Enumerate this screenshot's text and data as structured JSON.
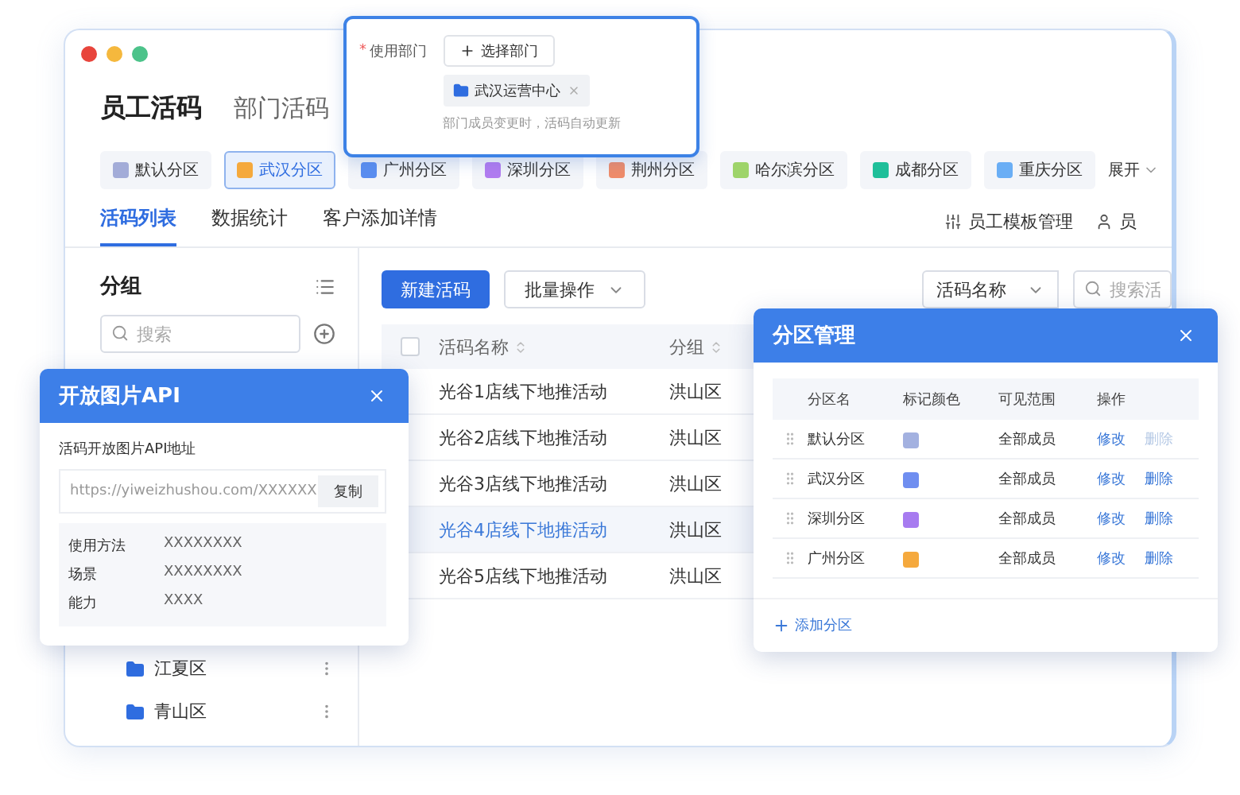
{
  "top_tabs": [
    {
      "label": "员工活码",
      "selected": true
    },
    {
      "label": "部门活码",
      "selected": false
    }
  ],
  "partitions": {
    "items": [
      {
        "label": "默认分区",
        "color": "#a3acd8",
        "selected": false
      },
      {
        "label": "武汉分区",
        "color": "#f5a93d",
        "selected": true
      },
      {
        "label": "广州分区",
        "color": "#5b8ef0",
        "selected": false
      },
      {
        "label": "深圳分区",
        "color": "#b27cf0",
        "selected": false
      },
      {
        "label": "荆州分区",
        "color": "#f08c6a",
        "selected": false
      },
      {
        "label": "哈尔滨分区",
        "color": "#9ed46a",
        "selected": false
      },
      {
        "label": "成都分区",
        "color": "#1fbf9a",
        "selected": false
      },
      {
        "label": "重庆分区",
        "color": "#6aaef5",
        "selected": false
      }
    ],
    "expand": "展开"
  },
  "sub_tabs": [
    {
      "label": "活码列表",
      "selected": true
    },
    {
      "label": "数据统计",
      "selected": false
    },
    {
      "label": "客户添加详情",
      "selected": false
    }
  ],
  "toolbar_links": [
    {
      "label": "员工模板管理",
      "kind": "template"
    },
    {
      "label": "员",
      "kind": "person"
    }
  ],
  "sidebar": {
    "title": "分组",
    "search_placeholder": "搜索",
    "groups": [
      {
        "label": "江夏区"
      },
      {
        "label": "青山区"
      }
    ]
  },
  "actions": {
    "primary": "新建活码",
    "batch": "批量操作",
    "filter": "活码名称",
    "search_placeholder": "搜索活"
  },
  "table": {
    "select_all": {
      "checked": false
    },
    "columns": [
      {
        "label": "活码名称",
        "sortable": true
      },
      {
        "label": "分组",
        "sortable": true
      }
    ],
    "rows": [
      {
        "name": "光谷1店线下地推活动",
        "group": "洪山区",
        "selected": false
      },
      {
        "name": "光谷2店线下地推活动",
        "group": "洪山区",
        "selected": false
      },
      {
        "name": "光谷3店线下地推活动",
        "group": "洪山区",
        "selected": false
      },
      {
        "name": "光谷4店线下地推活动",
        "group": "洪山区",
        "selected": true
      },
      {
        "name": "光谷5店线下地推活动",
        "group": "洪山区",
        "selected": false
      }
    ]
  },
  "dept_popup": {
    "label": "使用部门",
    "required_mark": "*",
    "button": "选择部门",
    "tag": "武汉运营中心",
    "hint": "部门成员变更时，活码自动更新"
  },
  "api_dialog": {
    "title": "开放图片API",
    "field_label": "活码开放图片API地址",
    "url": "https://yiweizhushou.com/XXXXXX",
    "copy": "复制",
    "details": [
      {
        "key": "使用方法",
        "value": "XXXXXXXX"
      },
      {
        "key": "场景",
        "value": "XXXXXXXX"
      },
      {
        "key": "能力",
        "value": "XXXX"
      }
    ]
  },
  "partition_dialog": {
    "title": "分区管理",
    "columns": [
      "分区名",
      "标记颜色",
      "可见范围",
      "操作"
    ],
    "rows": [
      {
        "name": "默认分区",
        "color": "#a3b1e0",
        "scope": "全部成员",
        "edit": "修改",
        "delete": "删除",
        "delete_disabled": true
      },
      {
        "name": "武汉分区",
        "color": "#6f8ef0",
        "scope": "全部成员",
        "edit": "修改",
        "delete": "删除",
        "delete_disabled": false
      },
      {
        "name": "深圳分区",
        "color": "#a77bf0",
        "scope": "全部成员",
        "edit": "修改",
        "delete": "删除",
        "delete_disabled": false
      },
      {
        "name": "广州分区",
        "color": "#f5a93d",
        "scope": "全部成员",
        "edit": "修改",
        "delete": "删除",
        "delete_disabled": false
      }
    ],
    "add": "添加分区"
  }
}
